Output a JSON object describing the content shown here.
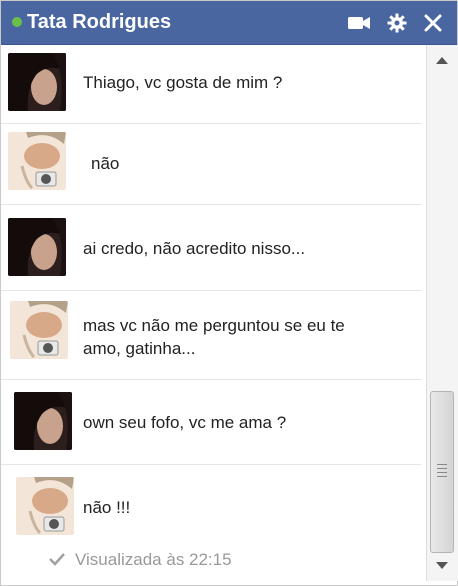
{
  "header": {
    "title": "Tata Rodrigues",
    "status_color": "#6cc04a",
    "accent": "#4a66a0",
    "icons": [
      "video-call-icon",
      "gear-icon",
      "close-icon"
    ]
  },
  "messages": [
    {
      "sender": "Thiago",
      "text": "Thiago, vc gosta de mim ?"
    },
    {
      "sender": "Tata",
      "text": "não"
    },
    {
      "sender": "Thiago",
      "text": "ai credo, não acredito nisso..."
    },
    {
      "sender": "Tata",
      "text": "mas vc não me perguntou se eu te amo, gatinha..."
    },
    {
      "sender": "Thiago",
      "text": "own seu fofo, vc me ama ?"
    },
    {
      "sender": "Tata",
      "text": "não !!!"
    }
  ],
  "status": {
    "seen": "Visualizada às 22:15",
    "icon": "checkmark-icon"
  }
}
